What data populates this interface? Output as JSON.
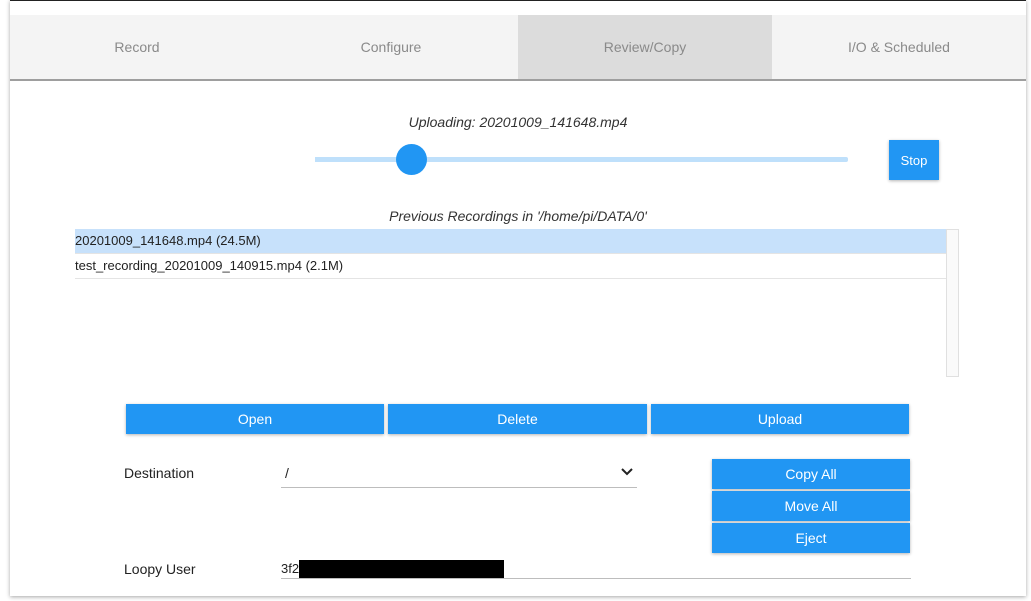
{
  "tabs": [
    {
      "label": "Record",
      "active": false
    },
    {
      "label": "Configure",
      "active": false
    },
    {
      "label": "Review/Copy",
      "active": true
    },
    {
      "label": "I/O & Scheduled",
      "active": false
    }
  ],
  "upload": {
    "status": "Uploading: 20201009_141648.mp4",
    "progress_percent": 18,
    "stop_label": "Stop"
  },
  "recordings": {
    "title": "Previous Recordings in '/home/pi/DATA/0'",
    "items": [
      {
        "label": "20201009_141648.mp4 (24.5M)",
        "selected": true
      },
      {
        "label": "test_recording_20201009_140915.mp4 (2.1M)",
        "selected": false
      }
    ]
  },
  "actions": {
    "open_label": "Open",
    "delete_label": "Delete",
    "upload_label": "Upload"
  },
  "destination": {
    "label": "Destination",
    "selected_value": "/",
    "copy_all_label": "Copy All",
    "move_all_label": "Move All",
    "eject_label": "Eject"
  },
  "loopy_user": {
    "label": "Loopy User",
    "value": "3f2"
  },
  "colors": {
    "accent": "#2196f3",
    "track": "#bfe0fb",
    "selected_row": "#c7e1fb",
    "active_tab": "#dcdcdc"
  },
  "icons": {
    "select_chevron": "chevron-down-icon"
  }
}
